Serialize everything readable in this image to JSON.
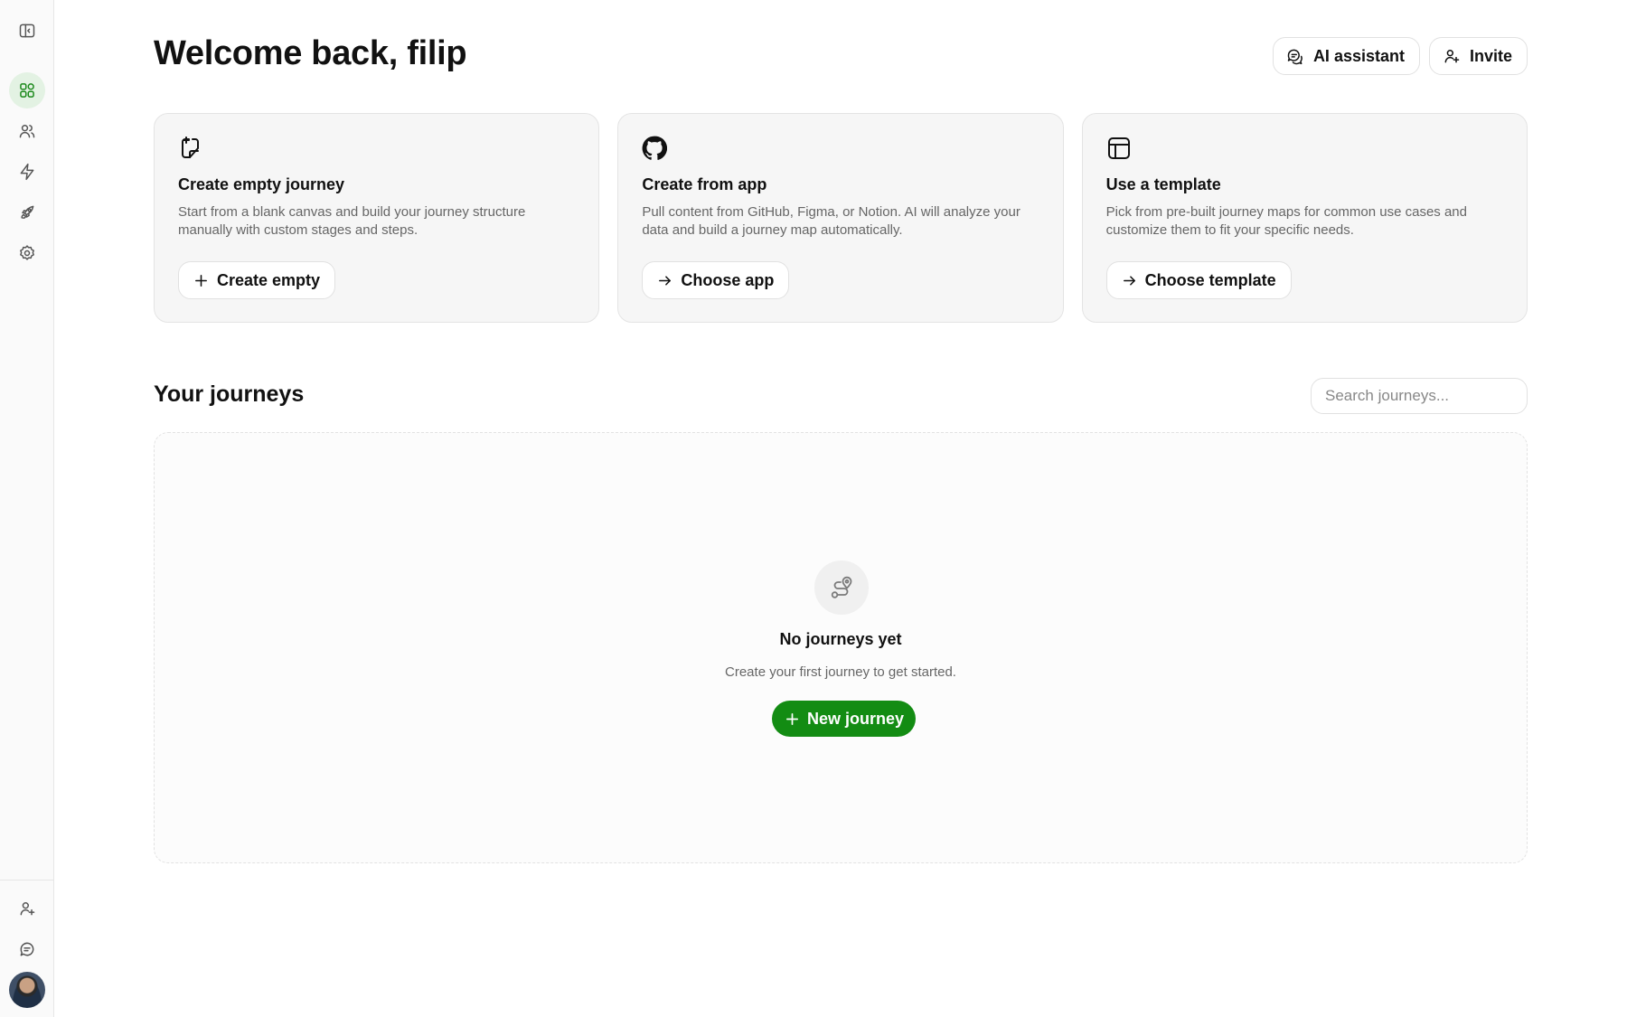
{
  "sidebar": {
    "top_items": [
      {
        "icon": "sidebar-toggle-icon"
      },
      {
        "icon": "dashboard-icon",
        "active": true
      },
      {
        "icon": "users-icon"
      },
      {
        "icon": "lightning-icon"
      },
      {
        "icon": "rocket-icon"
      },
      {
        "icon": "gear-icon"
      }
    ],
    "bottom_items": [
      {
        "icon": "user-plus-icon"
      },
      {
        "icon": "chat-icon"
      },
      {
        "icon": "avatar"
      }
    ],
    "active_color": "#1d8a1d"
  },
  "header": {
    "title": "Welcome back, filip",
    "ai_assistant_label": "AI assistant",
    "invite_label": "Invite"
  },
  "cards": [
    {
      "icon": "new-document-icon",
      "title": "Create empty journey",
      "description": "Start from a blank canvas and build your journey structure manually with custom stages and steps.",
      "button_label": "Create empty",
      "button_icon": "plus-icon"
    },
    {
      "icon": "github-icon",
      "title": "Create from app",
      "description": "Pull content from GitHub, Figma, or Notion. AI will analyze your data and build a journey map automatically.",
      "button_label": "Choose app",
      "button_icon": "arrow-right-icon"
    },
    {
      "icon": "template-icon",
      "title": "Use a template",
      "description": "Pick from pre-built journey maps for common use cases and customize them to fit your specific needs.",
      "button_label": "Choose template",
      "button_icon": "arrow-right-icon"
    }
  ],
  "journeys": {
    "title": "Your journeys",
    "search_placeholder": "Search journeys...",
    "empty_icon": "route-icon",
    "empty_title": "No journeys yet",
    "empty_subtitle": "Create your first journey to get started.",
    "new_button_label": "New journey",
    "accent_color": "#138c13"
  }
}
